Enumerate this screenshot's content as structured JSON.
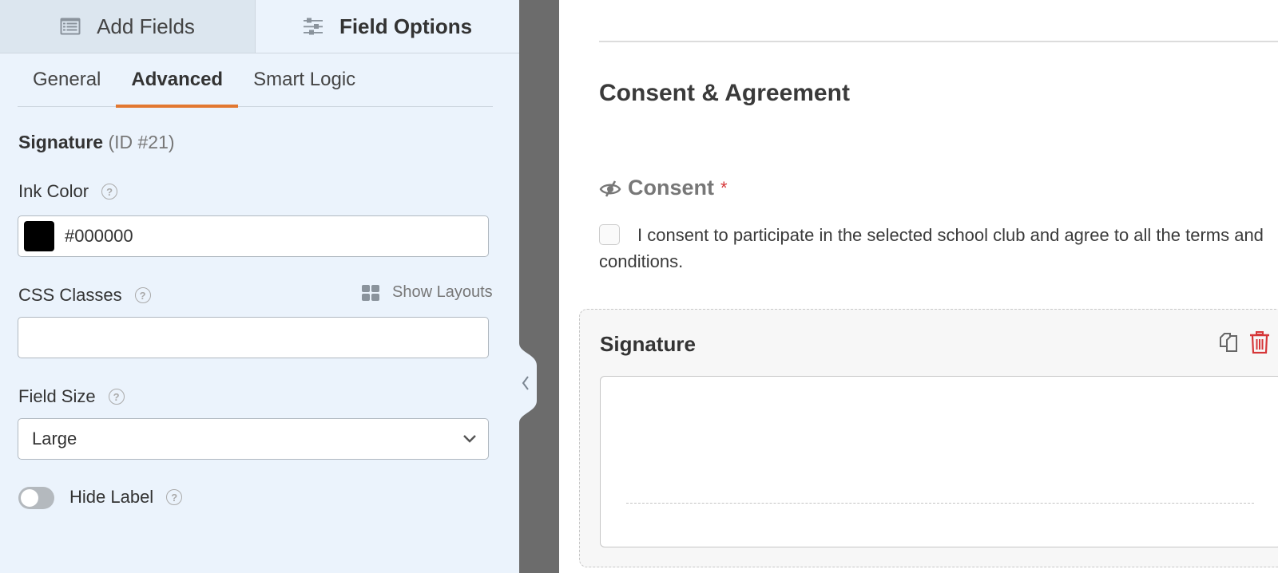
{
  "left_panel": {
    "top_tabs": [
      {
        "label": "Add Fields",
        "icon": "list-icon",
        "active": false
      },
      {
        "label": "Field Options",
        "icon": "sliders-icon",
        "active": true
      }
    ],
    "sub_tabs": [
      {
        "label": "General",
        "active": false
      },
      {
        "label": "Advanced",
        "active": true
      },
      {
        "label": "Smart Logic",
        "active": false
      }
    ],
    "field_title": {
      "name": "Signature",
      "id": "(ID #21)"
    },
    "ink_color": {
      "label": "Ink Color",
      "value": "#000000",
      "swatch_color": "#000000"
    },
    "css_classes": {
      "label": "CSS Classes",
      "value": "",
      "placeholder": "",
      "show_layouts_label": "Show Layouts"
    },
    "field_size": {
      "label": "Field Size",
      "selected": "Large"
    },
    "hide_label": {
      "label": "Hide Label",
      "enabled": false
    },
    "help_glyph": "?"
  },
  "form_preview": {
    "section_title": "Consent & Agreement",
    "consent": {
      "label": "Consent",
      "required_marker": "*",
      "text": "I consent to participate in the selected school club and agree to all the terms and conditions.",
      "checked": false
    },
    "signature": {
      "label": "Signature"
    }
  },
  "colors": {
    "accent": "#e27730",
    "panel_bg": "#ebf3fc",
    "divider": "#6c6c6c",
    "required": "#d63638",
    "delete": "#d63638"
  }
}
